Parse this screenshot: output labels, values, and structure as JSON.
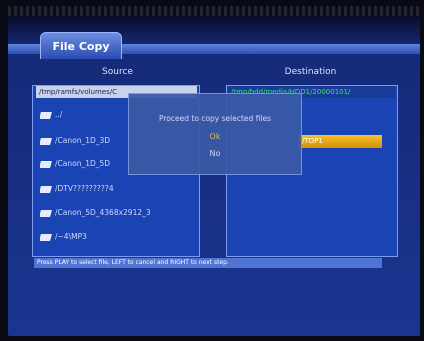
{
  "tab": {
    "label": "File Copy"
  },
  "source": {
    "heading": "Source",
    "path": "/tmp/ramfs/volumes/C",
    "items": [
      {
        "label": "../"
      },
      {
        "label": "/Canon_1D_3D"
      },
      {
        "label": "/Canon_1D_5D"
      },
      {
        "label": "/DTV?????????4"
      },
      {
        "label": "/Canon_5D_4368x2912_3"
      },
      {
        "label": "/~4\\MP3"
      }
    ]
  },
  "destination": {
    "heading": "Destination",
    "path": "/tmp/hdd/media/HDD1/20000101/",
    "selected_item": "/TOP1"
  },
  "dialog": {
    "message": "Proceed to copy selected files",
    "ok_label": "Ok",
    "no_label": "No"
  },
  "status_text": "Press PLAY to select file, LEFT to cancel and RIGHT to next step.",
  "colors": {
    "panel": "#1a43b4",
    "accent": "#f2b21a",
    "ok": "#f3c234",
    "path_text": "#3fe07a"
  }
}
